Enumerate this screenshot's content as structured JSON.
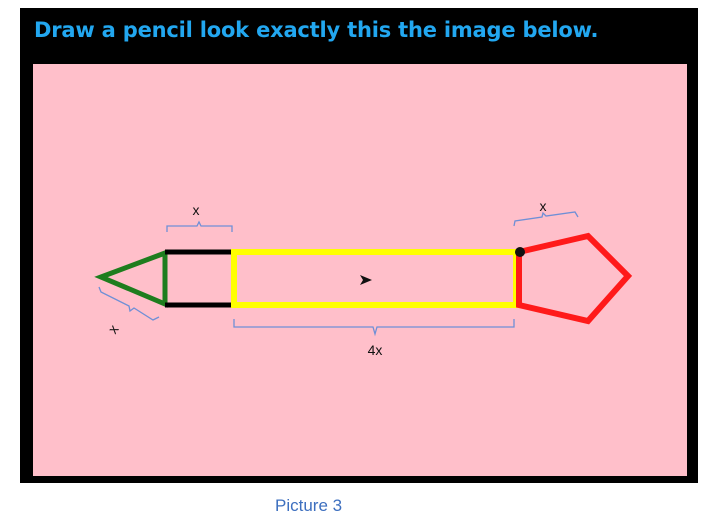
{
  "instruction": "Draw a pencil look exactly this the image below.",
  "caption": "Picture 3",
  "labels": {
    "band_width": "x",
    "body_length": "4x",
    "eraser_side": "x",
    "tip_side": "x"
  },
  "colors": {
    "frame": "#000000",
    "canvas": "#ffbfca",
    "title": "#22a7f0",
    "caption": "#3d6fbf",
    "tip": "#1e7d1e",
    "band": "#000000",
    "body": "#ffff00",
    "eraser": "#ff1a1a",
    "brace": "#6f8fd6"
  }
}
